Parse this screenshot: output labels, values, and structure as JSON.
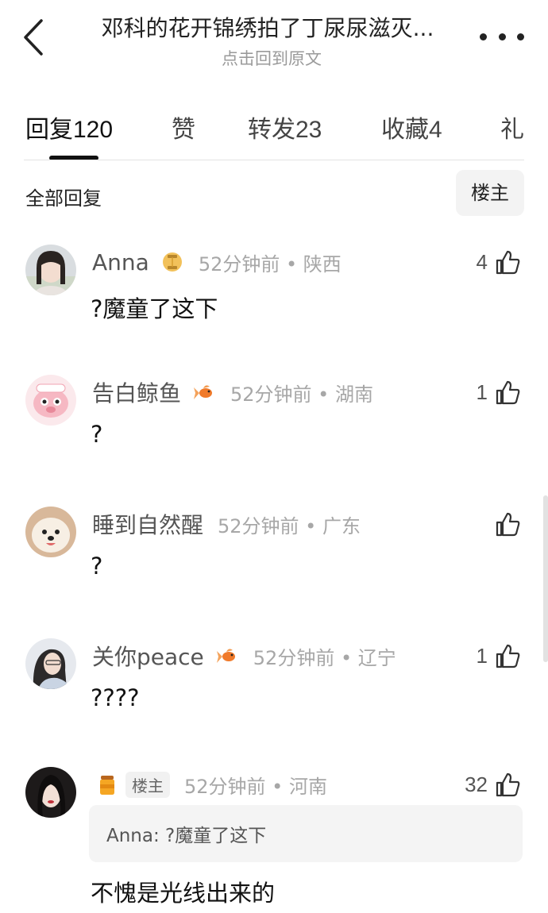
{
  "header": {
    "title": "邓科的花开锦绣拍了丁尿尿滋灭...",
    "subtitle": "点击回到原文"
  },
  "tabs": [
    {
      "label": "回复",
      "count": "120"
    },
    {
      "label": "赞",
      "count": ""
    },
    {
      "label": "转发",
      "count": "23"
    },
    {
      "label": "收藏",
      "count": "4"
    },
    {
      "label": "礼",
      "count": ""
    }
  ],
  "filter": {
    "label": "全部回复",
    "op_button": "楼主"
  },
  "comments": [
    {
      "username": "Anna",
      "badge": "lantern-icon",
      "meta": "52分钟前 • 陕西",
      "text": "?魔童了这下",
      "likes": "4"
    },
    {
      "username": "告白鲸鱼",
      "badge": "goldfish-icon",
      "meta": "52分钟前 • 湖南",
      "text": "?",
      "likes": "1"
    },
    {
      "username": "睡到自然醒",
      "badge": "",
      "meta": "52分钟前 • 广东",
      "text": "?",
      "likes": ""
    },
    {
      "username": "关你peace",
      "badge": "goldfish-icon",
      "meta": "52分钟前 • 辽宁",
      "text": "????",
      "likes": "1"
    },
    {
      "username": "",
      "badge": "honey-jar-icon",
      "tag": "楼主",
      "meta": "52分钟前 • 河南",
      "quote": "Anna: ?魔童了这下",
      "text": "不愧是光线出来的",
      "likes": "32"
    }
  ],
  "colors": {
    "text_primary": "#111111",
    "text_secondary": "#555555",
    "meta_gray": "#a7a7a7",
    "filter_bg": "#f3f3f3"
  }
}
